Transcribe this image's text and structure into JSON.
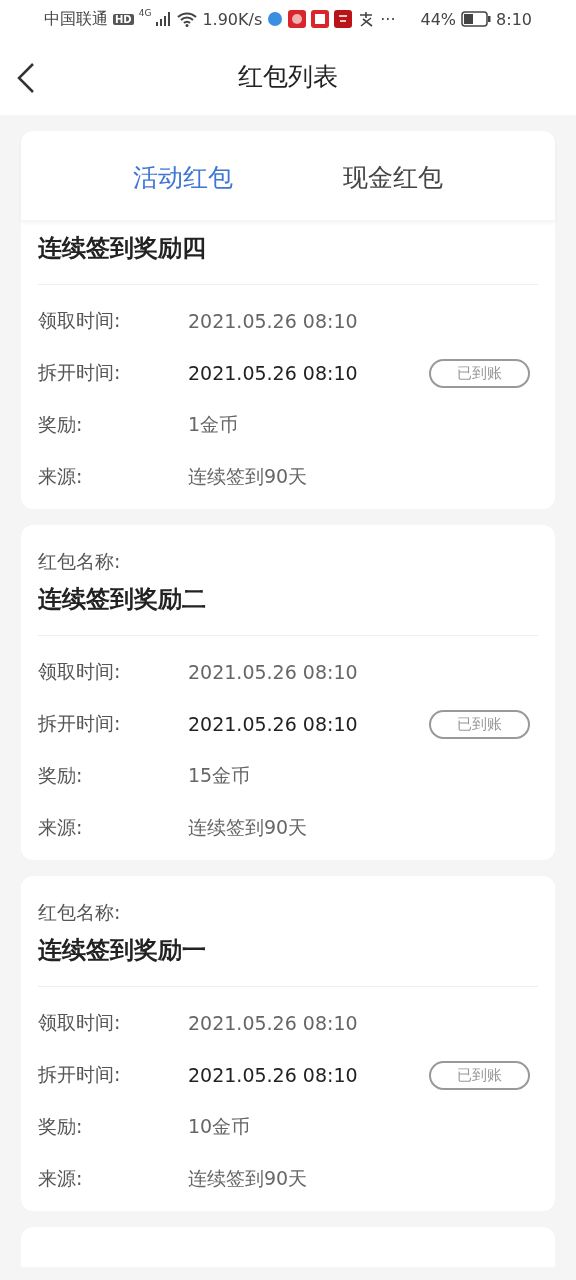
{
  "status_bar": {
    "carrier": "中国联通",
    "hd": "HD",
    "network": "4G",
    "speed": "1.90K/s",
    "more": "···",
    "battery": "44%",
    "time": "8:10"
  },
  "header": {
    "title": "红包列表"
  },
  "tabs": [
    {
      "label": "活动红包",
      "selected": true
    },
    {
      "label": "现金红包",
      "selected": false
    }
  ],
  "cards": [
    {
      "title": "连续签到奖励四",
      "rows": [
        {
          "label": "领取时间:",
          "value": "2021.05.26 08:10"
        },
        {
          "label": "拆开时间:",
          "value": "2021.05.26 08:10",
          "emphasis": true,
          "badge": "已到账"
        },
        {
          "label": "奖励:",
          "value": "1金币"
        },
        {
          "label": "来源:",
          "value": "连续签到90天"
        }
      ]
    },
    {
      "name_label": "红包名称:",
      "title": "连续签到奖励二",
      "rows": [
        {
          "label": "领取时间:",
          "value": "2021.05.26 08:10"
        },
        {
          "label": "拆开时间:",
          "value": "2021.05.26 08:10",
          "emphasis": true,
          "badge": "已到账"
        },
        {
          "label": "奖励:",
          "value": "15金币"
        },
        {
          "label": "来源:",
          "value": "连续签到90天"
        }
      ]
    },
    {
      "name_label": "红包名称:",
      "title": "连续签到奖励一",
      "rows": [
        {
          "label": "领取时间:",
          "value": "2021.05.26 08:10"
        },
        {
          "label": "拆开时间:",
          "value": "2021.05.26 08:10",
          "emphasis": true,
          "badge": "已到账"
        },
        {
          "label": "奖励:",
          "value": "10金币"
        },
        {
          "label": "来源:",
          "value": "连续签到90天"
        }
      ]
    }
  ]
}
